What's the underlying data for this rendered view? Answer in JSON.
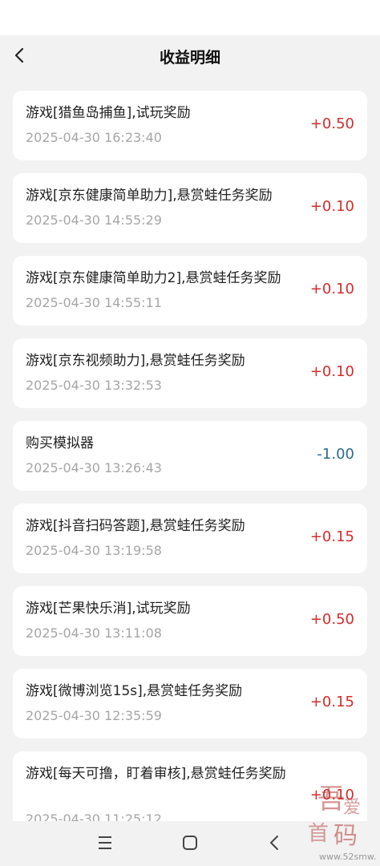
{
  "header": {
    "title": "收益明细",
    "back_icon": "chevron-left-icon"
  },
  "records": [
    {
      "title": "游戏[猎鱼岛捕鱼],试玩奖励",
      "time": "2025-04-30 16:23:40",
      "amount": "+0.50",
      "type": "income"
    },
    {
      "title": "游戏[京东健康简单助力],悬赏蛙任务奖励",
      "time": "2025-04-30 14:55:29",
      "amount": "+0.10",
      "type": "income"
    },
    {
      "title": "游戏[京东健康简单助力2],悬赏蛙任务奖励",
      "time": "2025-04-30 14:55:11",
      "amount": "+0.10",
      "type": "income"
    },
    {
      "title": "游戏[京东视频助力],悬赏蛙任务奖励",
      "time": "2025-04-30 13:32:53",
      "amount": "+0.10",
      "type": "income"
    },
    {
      "title": "购买模拟器",
      "time": "2025-04-30 13:26:43",
      "amount": "-1.00",
      "type": "expense"
    },
    {
      "title": "游戏[抖音扫码答题],悬赏蛙任务奖励",
      "time": "2025-04-30 13:19:58",
      "amount": "+0.15",
      "type": "income"
    },
    {
      "title": "游戏[芒果快乐消],试玩奖励",
      "time": "2025-04-30 13:11:08",
      "amount": "+0.50",
      "type": "income"
    },
    {
      "title": "游戏[微博浏览15s],悬赏蛙任务奖励",
      "time": "2025-04-30 12:35:59",
      "amount": "+0.15",
      "type": "income"
    },
    {
      "title": "游戏[每天可撸，盯着审核],悬赏蛙任务奖励",
      "time": "2025-04-30 11:25:12",
      "amount": "+0.10",
      "type": "income"
    }
  ],
  "colors": {
    "income": "#d42c2c",
    "expense": "#2a6b8c"
  },
  "navbar": {
    "menu_icon": "menu-icon",
    "home_icon": "square-home-icon",
    "back_icon": "triangle-back-icon"
  },
  "watermark": {
    "site": "www.52smw.cn",
    "glyphs": "吾爱首码"
  }
}
